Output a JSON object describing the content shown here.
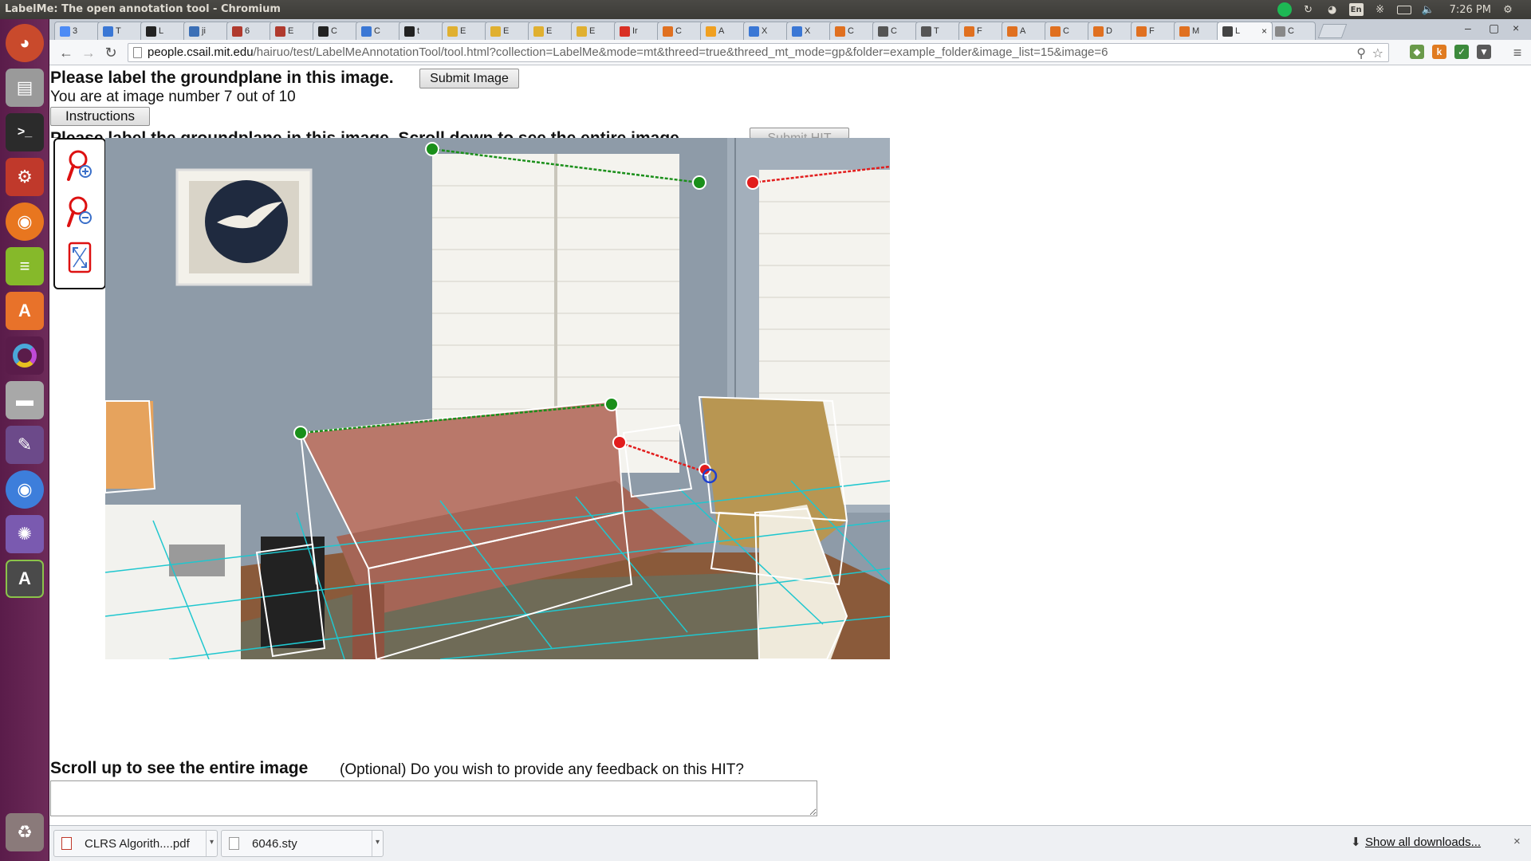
{
  "window": {
    "title": "LabelMe: The open annotation tool - Chromium"
  },
  "tray": {
    "language": "En",
    "clock": "7:26 PM"
  },
  "tabs": [
    {
      "label": "3",
      "color": "#4c8bf5"
    },
    {
      "label": "T",
      "color": "#3a77d5"
    },
    {
      "label": "L",
      "color": "#222222"
    },
    {
      "label": "ji",
      "color": "#3b6fb6"
    },
    {
      "label": "6",
      "color": "#b03a2e"
    },
    {
      "label": "E",
      "color": "#b03a2e"
    },
    {
      "label": "C",
      "color": "#222222"
    },
    {
      "label": "C",
      "color": "#3a77d5"
    },
    {
      "label": "t",
      "color": "#222222"
    },
    {
      "label": "E",
      "color": "#e0b030"
    },
    {
      "label": "E",
      "color": "#e0b030"
    },
    {
      "label": "E",
      "color": "#e0b030"
    },
    {
      "label": "E",
      "color": "#e0b030"
    },
    {
      "label": "Ir",
      "color": "#d93025"
    },
    {
      "label": "C",
      "color": "#e07020"
    },
    {
      "label": "A",
      "color": "#f0a020"
    },
    {
      "label": "X",
      "color": "#3a77d5"
    },
    {
      "label": "X",
      "color": "#3a77d5"
    },
    {
      "label": "C",
      "color": "#e07020"
    },
    {
      "label": "C",
      "color": "#555555"
    },
    {
      "label": "T",
      "color": "#555555"
    },
    {
      "label": "F",
      "color": "#e07020"
    },
    {
      "label": "A",
      "color": "#e07020"
    },
    {
      "label": "C",
      "color": "#e07020"
    },
    {
      "label": "D",
      "color": "#e07020"
    },
    {
      "label": "F",
      "color": "#e07020"
    },
    {
      "label": "M",
      "color": "#e07020"
    },
    {
      "label": "L",
      "color": "#444444",
      "active": true
    },
    {
      "label": "C",
      "color": "#888888"
    }
  ],
  "toolbar": {
    "url_host": "people.csail.mit.edu",
    "url_path": "/hairuo/test/LabelMeAnnotationTool/tool.html?collection=LabelMe&mode=mt&threed=true&threed_mt_mode=gp&folder=example_folder&image_list=15&image=6"
  },
  "page": {
    "title": "Please label the groundplane in this image.",
    "submit_image": "Submit Image",
    "progress": "You are at image number 7 out of 10",
    "instructions": "Instructions",
    "cut_heading": "Please label the groundplane in this image. Scroll down to see the entire image.",
    "submit_hit": "Submit HIT",
    "scroll_up": "Scroll up to see the entire image",
    "feedback_label": "(Optional) Do you wish to provide any feedback on this HIT?",
    "feedback_value": ""
  },
  "tools": [
    {
      "name": "zoom-in-icon"
    },
    {
      "name": "zoom-out-icon"
    },
    {
      "name": "fit-image-icon"
    }
  ],
  "colors": {
    "wall": "#8e9ba8",
    "groundplane_line": "#1a8f1a",
    "second_line": "#e21d1d",
    "grid": "#1fc7cf",
    "box": "#ffffff",
    "sofa": "#b9786a"
  },
  "downloads": {
    "items": [
      {
        "name": "CLRS Algorith....pdf"
      },
      {
        "name": "6046.sty"
      }
    ],
    "show_all": "Show all downloads..."
  }
}
